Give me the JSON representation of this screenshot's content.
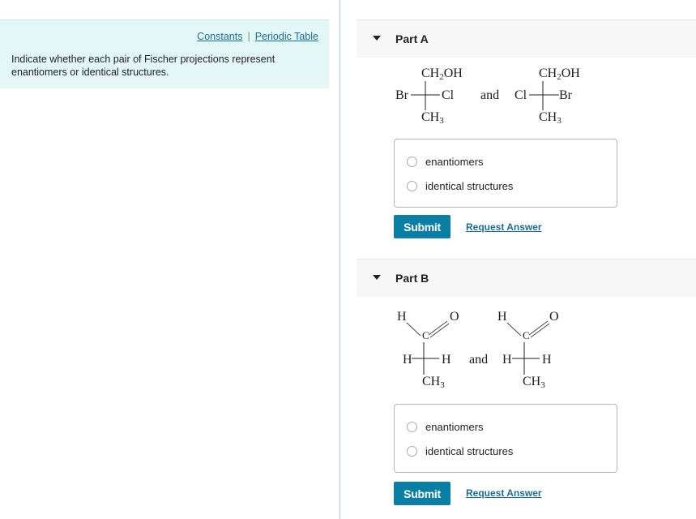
{
  "header_links": {
    "constants": "Constants",
    "separator": "|",
    "periodic_table": "Periodic Table"
  },
  "instructions": "Indicate whether each pair of Fischer projections represent enantiomers or identical structures.",
  "parts": [
    {
      "title": "Part A",
      "structure": {
        "left": {
          "top": "CH2OH",
          "left": "Br",
          "right": "Cl",
          "bottom": "CH3"
        },
        "connector": "and",
        "right": {
          "top": "CH2OH",
          "left": "Cl",
          "right": "Br",
          "bottom": "CH3"
        }
      },
      "options": [
        "enantiomers",
        "identical structures"
      ],
      "selected": null,
      "submit_label": "Submit",
      "request_label": "Request Answer"
    },
    {
      "title": "Part B",
      "structure": {
        "left": {
          "aldehyde_h": "H",
          "aldehyde_o": "O",
          "carbonyl_c": "C",
          "left": "H",
          "right": "H",
          "bottom": "CH3"
        },
        "connector": "and",
        "right": {
          "aldehyde_h": "H",
          "aldehyde_o": "O",
          "carbonyl_c": "C",
          "left": "H",
          "right": "H",
          "bottom": "CH3"
        }
      },
      "options": [
        "enantiomers",
        "identical structures"
      ],
      "selected": null,
      "submit_label": "Submit",
      "request_label": "Request Answer"
    }
  ],
  "colors": {
    "accent": "#0a7ea3",
    "link": "#1a6d95",
    "info_bg": "#e3f7f6"
  }
}
